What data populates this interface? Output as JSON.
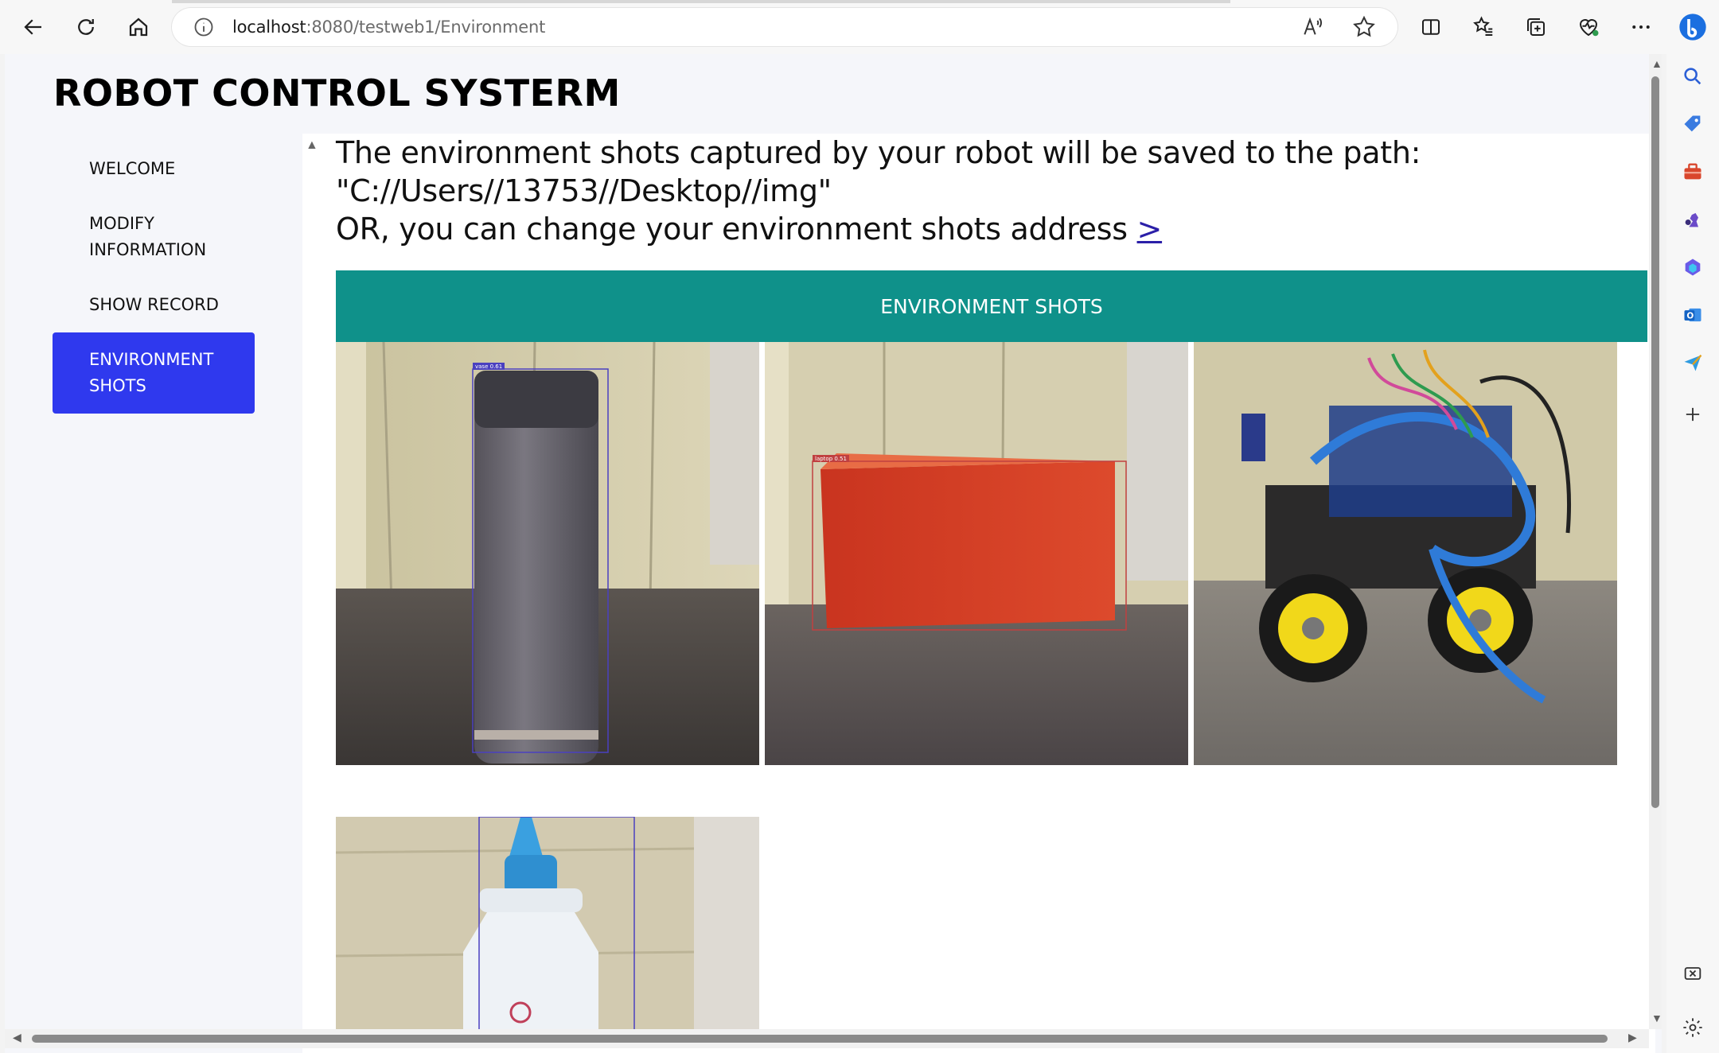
{
  "browser": {
    "url_host": "localhost",
    "url_rest": ":8080/testweb1/Environment"
  },
  "app": {
    "title": "ROBOT CONTROL SYSTERM"
  },
  "sidebar": {
    "items": [
      {
        "label": "WELCOME",
        "active": false
      },
      {
        "label": "MODIFY INFORMATION",
        "active": false
      },
      {
        "label": "SHOW RECORD",
        "active": false
      },
      {
        "label": "ENVIRONMENT SHOTS",
        "active": true
      }
    ]
  },
  "main": {
    "line1": "The environment shots captured by your robot will be saved to the path:",
    "line2": "\"C://Users//13753//Desktop//img\"",
    "line3": "OR, you can change your environment shots address ",
    "change_link": ">",
    "section_title": "ENVIRONMENT SHOTS",
    "shots": [
      {
        "subject": "thermos bottle",
        "detection_label": "vase 0.61"
      },
      {
        "subject": "orange box",
        "detection_label": "laptop 0.51"
      },
      {
        "subject": "robot car",
        "detection_label": ""
      },
      {
        "subject": "glue bottle",
        "detection_label": ""
      }
    ]
  },
  "colors": {
    "accent_nav": "#2f39ee",
    "section_header": "#0f918a",
    "link": "#2b1fa8"
  }
}
